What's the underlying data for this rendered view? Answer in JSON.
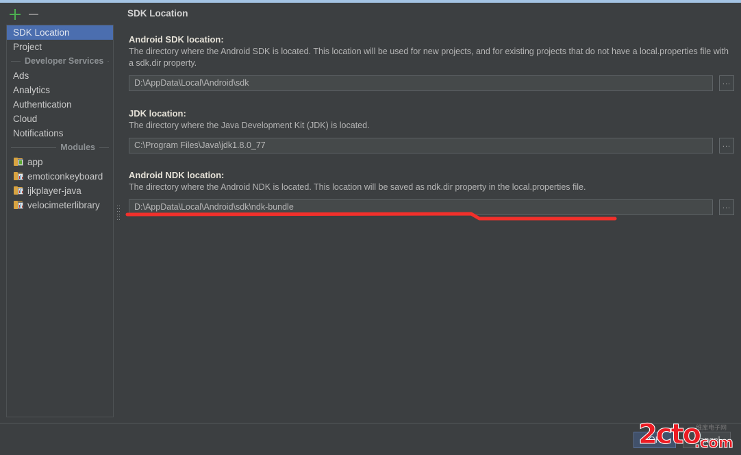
{
  "toolbar": {
    "add_label": "+",
    "remove_label": "−"
  },
  "sidebar": {
    "items": [
      {
        "label": "SDK Location",
        "selected": true,
        "type": "item"
      },
      {
        "label": "Project",
        "selected": false,
        "type": "item"
      },
      {
        "label": "Developer Services",
        "type": "separator"
      },
      {
        "label": "Ads",
        "selected": false,
        "type": "item"
      },
      {
        "label": "Analytics",
        "selected": false,
        "type": "item"
      },
      {
        "label": "Authentication",
        "selected": false,
        "type": "item"
      },
      {
        "label": "Cloud",
        "selected": false,
        "type": "item"
      },
      {
        "label": "Notifications",
        "selected": false,
        "type": "item"
      },
      {
        "label": "Modules",
        "type": "separator"
      },
      {
        "label": "app",
        "type": "module",
        "icon": "android-app-module-icon"
      },
      {
        "label": "emoticonkeyboard",
        "type": "module",
        "icon": "android-library-module-icon"
      },
      {
        "label": "ijkplayer-java",
        "type": "module",
        "icon": "android-library-module-icon"
      },
      {
        "label": "velocimeterlibrary",
        "type": "module",
        "icon": "android-library-module-icon"
      }
    ],
    "separator_developer_services": "Developer Services",
    "separator_modules": "Modules"
  },
  "main": {
    "title": "SDK Location",
    "sections": [
      {
        "label": "Android SDK location:",
        "description": "The directory where the Android SDK is located. This location will be used for new projects, and for existing projects that do not have a local.properties file with a sdk.dir property.",
        "value": "D:\\AppData\\Local\\Android\\sdk",
        "browse_label": "...",
        "name": "android-sdk-location"
      },
      {
        "label": "JDK location:",
        "description": "The directory where the Java Development Kit (JDK) is located.",
        "value": "C:\\Program Files\\Java\\jdk1.8.0_77",
        "browse_label": "...",
        "name": "jdk-location"
      },
      {
        "label": "Android NDK location:",
        "description": "The directory where the Android NDK is located. This location will be saved as ndk.dir property in the local.properties file.",
        "value": "D:\\AppData\\Local\\Android\\sdk\\ndk-bundle",
        "browse_label": "...",
        "name": "android-ndk-location"
      }
    ]
  },
  "footer": {
    "ok_label": "OK",
    "cancel_label": "Cancel"
  },
  "watermark": {
    "text": "2cto",
    "suffix": ".com",
    "subtitle": "维库电子网"
  },
  "colors": {
    "background": "#3c3f41",
    "selection": "#4b6eaf",
    "accent_top": "#a4c4e4",
    "annotation": "#ec1c24",
    "add_icon": "#4caf50",
    "field_bg": "#45494a",
    "folder_icon": "#d9a441"
  }
}
